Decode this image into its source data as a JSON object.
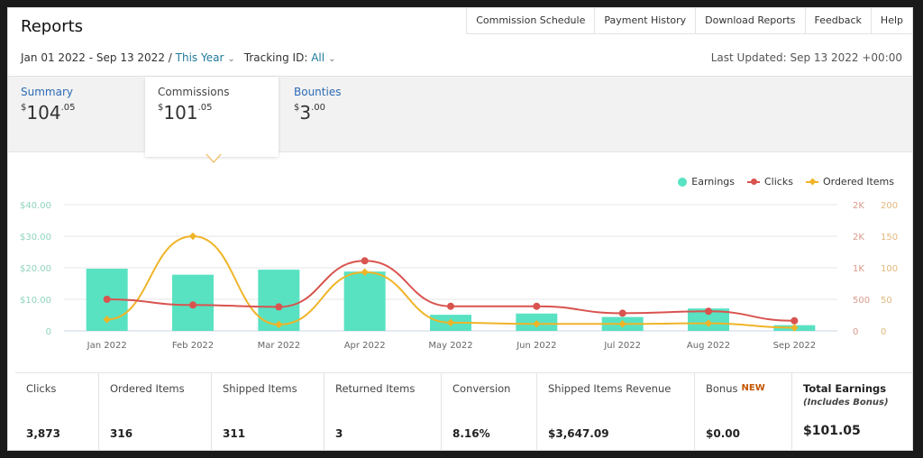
{
  "header": {
    "title": "Reports",
    "nav": [
      "Commission Schedule",
      "Payment History",
      "Download Reports",
      "Feedback",
      "Help"
    ],
    "date_range": "Jan 01 2022 - Sep 13 2022 /",
    "period": "This Year",
    "tracking_label": "Tracking ID:",
    "tracking_value": "All",
    "last_updated": "Last Updated: Sep 13 2022 +00:00"
  },
  "tabs": [
    {
      "label": "Summary",
      "currency": "$",
      "whole": "104",
      "cents": ".05",
      "active": false
    },
    {
      "label": "Commissions",
      "currency": "$",
      "whole": "101",
      "cents": ".05",
      "active": true
    },
    {
      "label": "Bounties",
      "currency": "$",
      "whole": "3",
      "cents": ".00",
      "active": false
    }
  ],
  "colors": {
    "earnings": "#58e2c2",
    "clicks": "#d9534f",
    "ordered": "#f0b429",
    "link": "#2b6bb5",
    "new_badge": "#c45500"
  },
  "chart_data": {
    "type": "bar",
    "categories": [
      "Jan 2022",
      "Feb 2022",
      "Mar 2022",
      "Apr 2022",
      "May 2022",
      "Jun 2022",
      "Jul 2022",
      "Aug 2022",
      "Sep 2022"
    ],
    "series": [
      {
        "name": "Earnings",
        "type": "bar",
        "axis": "left",
        "values": [
          19.7,
          17.8,
          19.4,
          18.8,
          5.1,
          5.5,
          4.4,
          7.1,
          1.8
        ]
      },
      {
        "name": "Clicks",
        "type": "line",
        "axis": "right1",
        "values": [
          500,
          410,
          380,
          1110,
          390,
          390,
          280,
          310,
          160
        ]
      },
      {
        "name": "Ordered Items",
        "type": "line",
        "axis": "right2",
        "values": [
          18,
          150,
          10,
          93,
          13,
          11,
          11,
          12,
          5
        ]
      }
    ],
    "left_axis": {
      "ticks": [
        "0",
        "$10.00",
        "$20.00",
        "$30.00",
        "$40.00"
      ],
      "range": [
        0,
        40
      ]
    },
    "right_axis_1": {
      "ticks": [
        "0",
        "500",
        "1K",
        "2K",
        "2K"
      ],
      "range": [
        0,
        2000
      ]
    },
    "right_axis_2": {
      "ticks": [
        "0",
        "50",
        "100",
        "150",
        "200"
      ],
      "range": [
        0,
        200
      ]
    },
    "legend": [
      "Earnings",
      "Clicks",
      "Ordered Items"
    ],
    "legend_position": "top-right",
    "grid": true
  },
  "metrics": [
    {
      "label": "Clicks",
      "value": "3,873"
    },
    {
      "label": "Ordered Items",
      "value": "316"
    },
    {
      "label": "Shipped Items",
      "value": "311"
    },
    {
      "label": "Returned Items",
      "value": "3"
    },
    {
      "label": "Conversion",
      "value": "8.16%"
    },
    {
      "label": "Shipped Items Revenue",
      "value": "$3,647.09"
    },
    {
      "label": "Bonus",
      "badge": "NEW",
      "value": "$0.00"
    },
    {
      "label": "Total Earnings",
      "sub": "(Includes Bonus)",
      "value": "$101.05"
    }
  ]
}
